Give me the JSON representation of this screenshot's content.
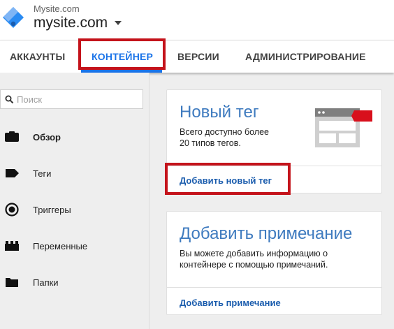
{
  "header": {
    "account_small": "Mysite.com",
    "container_name": "mysite.com"
  },
  "tabs": [
    {
      "label": "АККАУНТЫ"
    },
    {
      "label": "КОНТЕЙНЕР",
      "active": true
    },
    {
      "label": "ВЕРСИИ"
    },
    {
      "label": "АДМИНИСТРИРОВАНИЕ"
    }
  ],
  "sidebar": {
    "search_placeholder": "Поиск",
    "items": [
      {
        "label": "Обзор",
        "icon": "briefcase-icon",
        "active": true
      },
      {
        "label": "Теги",
        "icon": "tag-icon"
      },
      {
        "label": "Триггеры",
        "icon": "trigger-icon"
      },
      {
        "label": "Переменные",
        "icon": "blocks-icon"
      },
      {
        "label": "Папки",
        "icon": "folder-icon"
      }
    ]
  },
  "cards": {
    "new_tag": {
      "title": "Новый тег",
      "desc_line1": "Всего доступно более",
      "desc_line2": "20 типов тегов.",
      "link": "Добавить новый тег"
    },
    "add_note": {
      "title": "Добавить примечание",
      "desc_line1": "Вы можете добавить информацию о",
      "desc_line2": "контейнере с помощью примечаний.",
      "link": "Добавить примечание"
    }
  },
  "colors": {
    "accent": "#1a73e8",
    "highlight": "#c4131b",
    "card_title": "#3f7bbf"
  }
}
